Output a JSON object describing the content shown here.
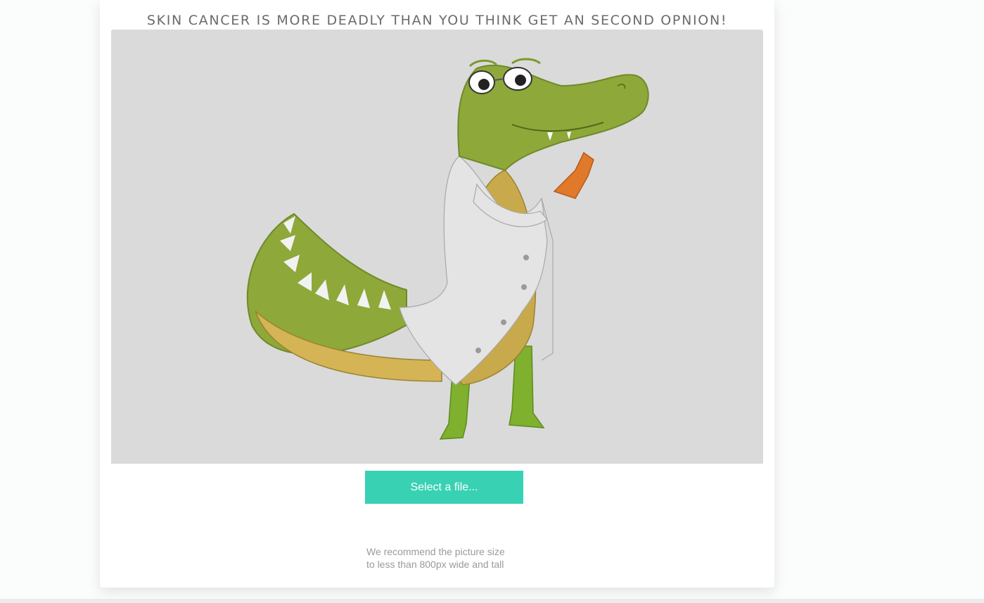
{
  "page": {
    "headline": "SKIN CANCER IS MORE DEADLY THAN YOU THINK GET AN SECOND OPNION!"
  },
  "preview": {
    "illustration": "cartoon crocodile doctor in lab coat",
    "background_color": "#dadada"
  },
  "upload": {
    "select_label": "Select a file...",
    "button_color": "#38d1b4"
  },
  "hint": {
    "line1": "We recommend the picture size",
    "line2": "to less than 800px wide and tall"
  }
}
